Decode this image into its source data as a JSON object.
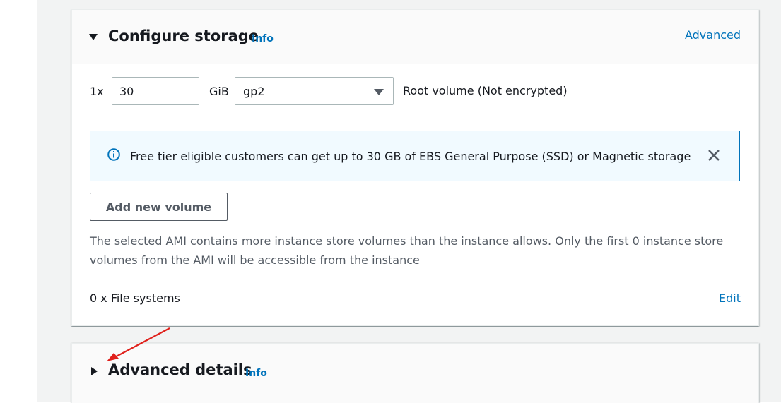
{
  "storage": {
    "title": "Configure storage",
    "info": "Info",
    "advanced_link": "Advanced",
    "volume": {
      "count_label": "1x",
      "size_value": "30",
      "size_unit": "GiB",
      "type_selected": "gp2",
      "root_label": "Root volume  (Not encrypted)"
    },
    "alert": {
      "icon": "info-circle-icon",
      "message": "Free tier eligible customers can get up to 30 GB of EBS General Purpose (SSD) or Magnetic storage",
      "color": "#0073bb"
    },
    "add_volume_button": "Add new volume",
    "note": "The selected AMI contains more instance store volumes than the instance allows. Only the first 0 instance store volumes from the AMI will be accessible from the instance",
    "file_systems_label": "0 x File systems",
    "edit_link": "Edit"
  },
  "advanced_details": {
    "title": "Advanced details",
    "info": "Info"
  },
  "colors": {
    "link": "#0073bb",
    "annotation_arrow": "#e0201b"
  }
}
